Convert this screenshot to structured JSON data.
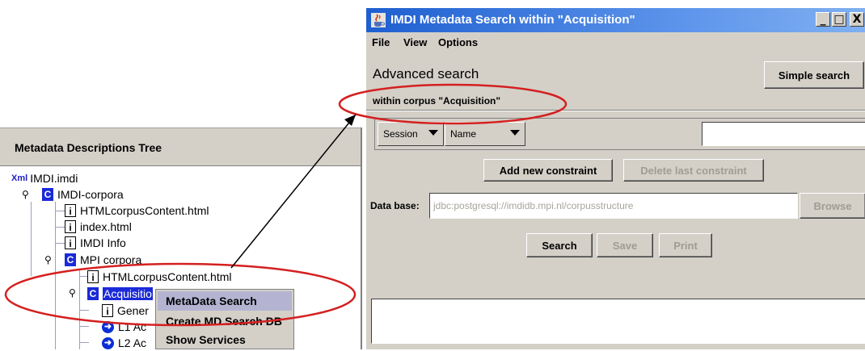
{
  "tree": {
    "title": "Metadata Descriptions Tree",
    "nodes": [
      {
        "label": "IMDI.imdi",
        "icon": "xml-icon"
      },
      {
        "label": "IMDI-corpora",
        "icon": "corpus-icon"
      },
      {
        "label": "HTMLcorpusContent.html",
        "icon": "info-icon"
      },
      {
        "label": "index.html",
        "icon": "info-icon"
      },
      {
        "label": "IMDI Info",
        "icon": "info-icon"
      },
      {
        "label": "MPI corpora",
        "icon": "corpus-icon"
      },
      {
        "label": "HTMLcorpusContent.html",
        "icon": "info-icon"
      },
      {
        "label": "Acquisitio",
        "icon": "corpus-icon"
      },
      {
        "label": "Gener",
        "icon": "info-icon"
      },
      {
        "label": "L1 Ac",
        "icon": "arrow-icon"
      },
      {
        "label": "L2 Ac",
        "icon": "arrow-icon"
      }
    ],
    "icon_glyphs": {
      "corpus": "C",
      "info": "i",
      "xml": "Xml"
    }
  },
  "context_menu": {
    "items": [
      "MetaData Search",
      "Create MD Search DB",
      "Show Services"
    ],
    "highlight_color": "#b4b4d2"
  },
  "window": {
    "title": "IMDI Metadata Search within \"Acquisition\"",
    "controls": {
      "minimize": "_",
      "maximize": "□",
      "close": "X"
    },
    "menu": [
      "File",
      "View",
      "Options"
    ],
    "heading": "Advanced search",
    "simple_search_label": "Simple search",
    "within_text": "within corpus \"Acquisition\"",
    "constraint": {
      "scope": "Session",
      "field": "Name",
      "value": ""
    },
    "add_constraint_label": "Add new constraint",
    "delete_constraint_label": "Delete last constraint",
    "database": {
      "label": "Data base:",
      "value": "jdbc:postgresql://imdidb.mpi.nl/corpusstructure",
      "browse_label": "Browse"
    },
    "actions": {
      "search": "Search",
      "save": "Save",
      "print": "Print"
    },
    "titlebar_color": "#1e5fd0"
  },
  "annotation_color": "#d42020"
}
